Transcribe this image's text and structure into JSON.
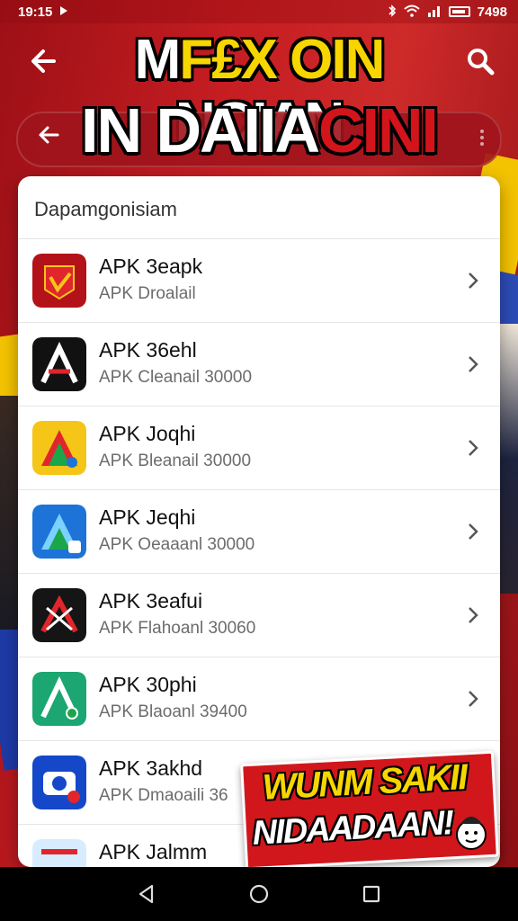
{
  "status_bar": {
    "time": "19:15",
    "battery_text": "7498"
  },
  "headline": {
    "line1_a": "M",
    "line1_b": "F£X",
    "line1_c": " OIN",
    "line1_d": " NCIAN",
    "line2_a": "IN DAIIA",
    "line2_b": "CINI"
  },
  "list": {
    "header": "Dapamgonisiam",
    "items": [
      {
        "title": "APK 3eapk",
        "subtitle": "APK  Droalail",
        "icon": "red-shield-app-icon",
        "icon_bg": "#c4161c"
      },
      {
        "title": "APK 36ehl",
        "subtitle": "APK  Cleanail   30000",
        "icon": "black-a-app-icon",
        "icon_bg": "#111111"
      },
      {
        "title": "APK Joqhi",
        "subtitle": "APK  Bleanail   30000",
        "icon": "yellow-a-app-icon",
        "icon_bg": "#f5c518"
      },
      {
        "title": "APK Jeqhi",
        "subtitle": "APK  Oeaaanl   30000",
        "icon": "blue-a-app-icon",
        "icon_bg": "#1e73d8"
      },
      {
        "title": "APK 3eafui",
        "subtitle": "APK  Flahoanl   30060",
        "icon": "black-x-app-icon",
        "icon_bg": "#151515"
      },
      {
        "title": "APK 30phi",
        "subtitle": "APK  Blaoanl   39400",
        "icon": "green-a-app-icon",
        "icon_bg": "#1ba672"
      },
      {
        "title": "APK 3akhd",
        "subtitle": "APK  Dmaoaili   36",
        "icon": "blue-camera-app-icon",
        "icon_bg": "#1547c9"
      },
      {
        "title": "APK Jalmm",
        "subtitle": "",
        "icon": "partial-app-icon",
        "icon_bg": "#d8ecff"
      }
    ]
  },
  "promo": {
    "line1": "WUNM SAKII",
    "line2": "NIDAADAAN!"
  },
  "colors": {
    "brand_red": "#c51d22",
    "accent_yellow": "#f7d600"
  }
}
